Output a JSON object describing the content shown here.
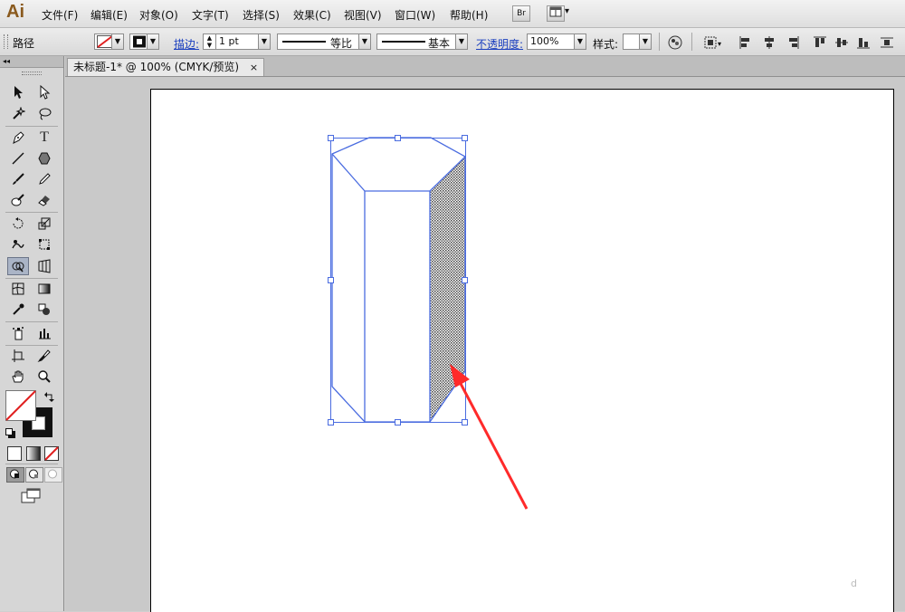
{
  "app": {
    "logo": "Ai"
  },
  "menu": [
    "文件(F)",
    "编辑(E)",
    "对象(O)",
    "文字(T)",
    "选择(S)",
    "效果(C)",
    "视图(V)",
    "窗口(W)",
    "帮助(H)"
  ],
  "menu_buttons": {
    "bridge": "Br",
    "arrange_arrow": "▾"
  },
  "control_bar": {
    "selection_type": "路径",
    "stroke_label": "描边:",
    "stroke_weight": "1 pt",
    "stroke_profile": "等比",
    "brush": "基本",
    "opacity_label": "不透明度:",
    "opacity_value": "100%",
    "style_label": "样式:",
    "dropdown_arrow": "▼"
  },
  "document_tab": {
    "title": "未标题-1* @ 100% (CMYK/预览)",
    "close": "×"
  },
  "tools_header": "◂◂",
  "watermark": "d",
  "icons": [
    "selection-arrow",
    "direct-selection-arrow",
    "magic-wand",
    "lasso",
    "pen",
    "type",
    "line",
    "polygon",
    "paintbrush",
    "pencil",
    "blob-brush",
    "eraser",
    "rotate",
    "scale",
    "warp",
    "free-transform",
    "shape-builder",
    "perspective-grid",
    "mesh",
    "gradient",
    "eyedropper",
    "blend",
    "symbol-sprayer",
    "column-graph",
    "artboard",
    "slice",
    "hand",
    "zoom"
  ],
  "colors": {
    "selection": "#4a6ce0",
    "arrow": "#ff2a2a",
    "menubar": "#e8e8e8",
    "canvas_bg": "#c9c9c9"
  }
}
